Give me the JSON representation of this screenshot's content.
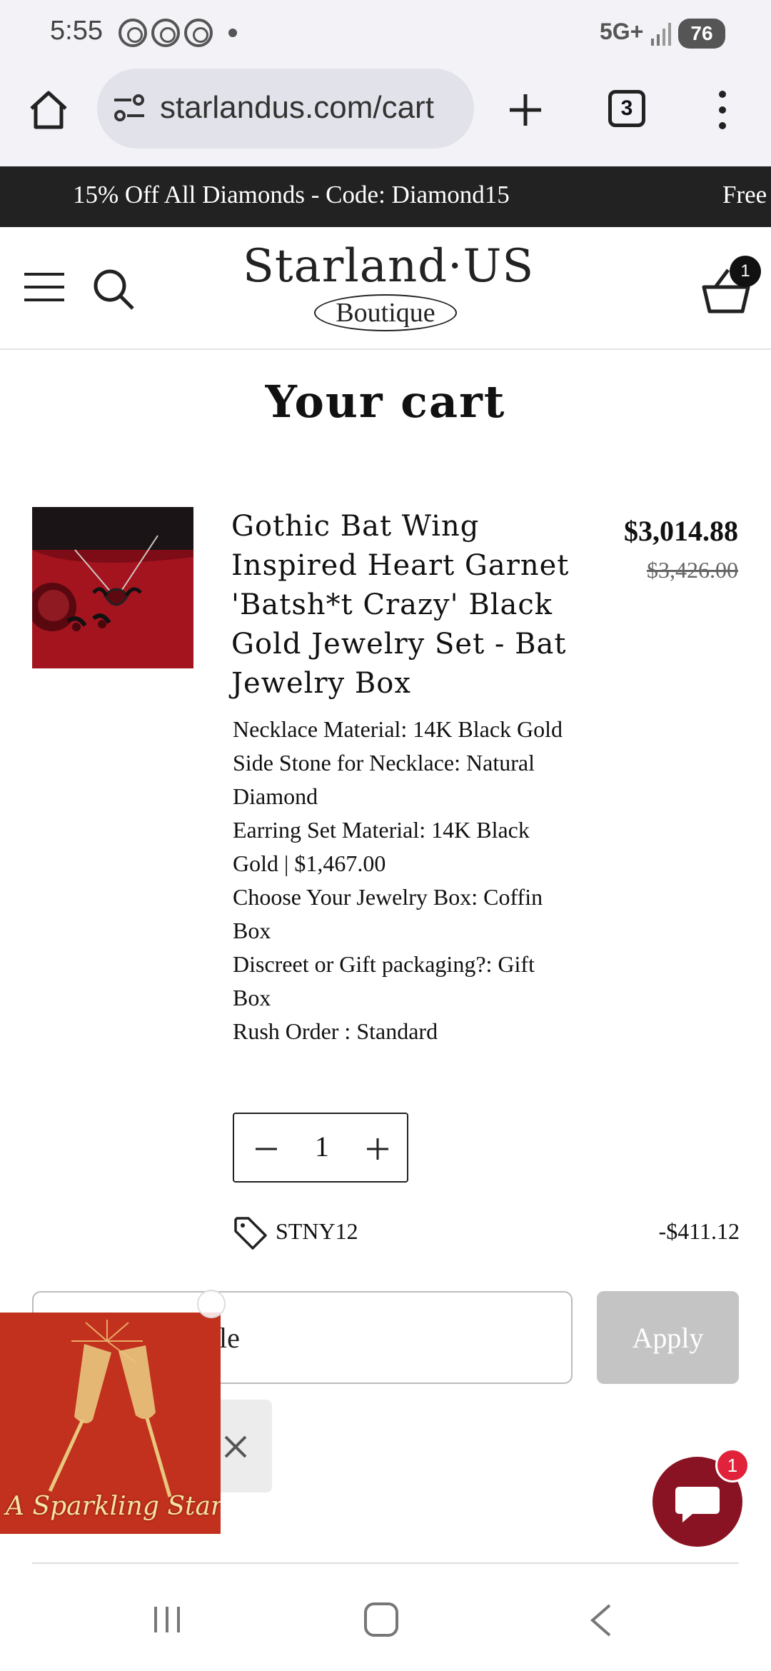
{
  "status_bar": {
    "time": "5:55",
    "network": "5G+",
    "battery": "76"
  },
  "browser": {
    "url": "starlandus.com/cart",
    "tab_count": "3"
  },
  "promo_bar": {
    "text": "15% Off All Diamonds - Code: Diamond15",
    "text_next": "Free"
  },
  "header": {
    "logo_top": "Starland·US",
    "logo_bottom": "Boutique",
    "cart_count": "1"
  },
  "page_title": "Your cart",
  "item": {
    "title": "Gothic Bat Wing Inspired Heart Garnet 'Batsh*t Crazy' Black Gold Jewelry Set - Bat Jewelry Box",
    "price_sale": "$3,014.88",
    "price_original": "$3,426.00",
    "options": [
      "Necklace Material: 14K Black Gold",
      "Side Stone for Necklace: Natural Diamond",
      "Earring Set Material: 14K Black Gold | $1,467.00",
      "Choose Your Jewelry Box: Coffin Box",
      "Discreet or Gift packaging?: Gift Box",
      "Rush Order : Standard"
    ],
    "quantity": "1",
    "discount_code": "STNY12",
    "discount_amount": "-$411.12"
  },
  "discount_form": {
    "input_value": "le",
    "apply_label": "Apply"
  },
  "popup": {
    "caption": "A Sparkling Start"
  },
  "chat": {
    "badge": "1"
  },
  "colors": {
    "promo_bg": "#222222",
    "chat_bg": "#8a1323",
    "badge_red": "#e0233a",
    "apply_disabled": "#c4c4c4",
    "popup_bg": "#c1311d"
  }
}
